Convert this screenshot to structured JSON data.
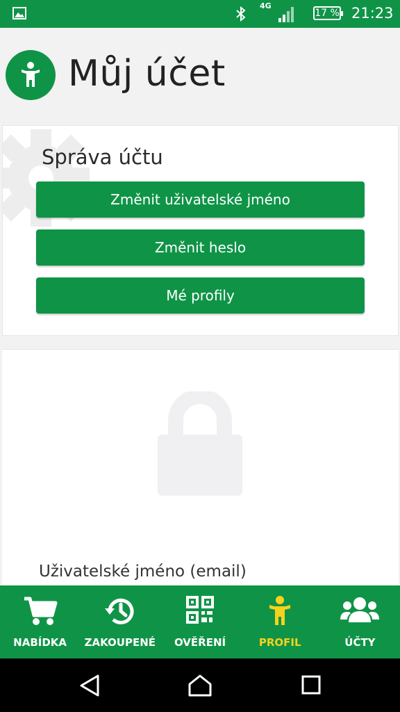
{
  "status_bar": {
    "network": "4G",
    "battery": "17 %",
    "time": "21:23"
  },
  "header": {
    "title": "Můj účet"
  },
  "account_card": {
    "title": "Správa účtu",
    "buttons": [
      {
        "label": "Změnit uživatelské jméno"
      },
      {
        "label": "Změnit heslo"
      },
      {
        "label": "Mé profily"
      }
    ]
  },
  "credentials_card": {
    "field_label": "Uživatelské jméno (email)"
  },
  "bottom_nav": {
    "items": [
      {
        "label": "NABÍDKA",
        "icon": "cart-icon",
        "active": false
      },
      {
        "label": "ZAKOUPENÉ",
        "icon": "history-icon",
        "active": false
      },
      {
        "label": "OVĚŘENÍ",
        "icon": "qr-code-icon",
        "active": false
      },
      {
        "label": "PROFIL",
        "icon": "person-icon",
        "active": true
      },
      {
        "label": "ÚČTY",
        "icon": "users-icon",
        "active": false
      }
    ]
  },
  "colors": {
    "brand_green": "#0f9447",
    "active_yellow": "#f7d21c"
  }
}
